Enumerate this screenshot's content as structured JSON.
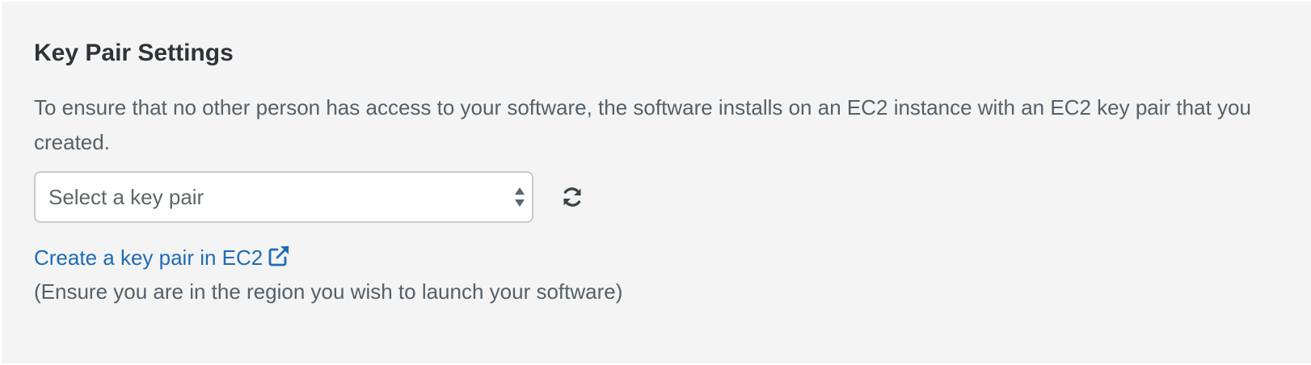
{
  "section": {
    "title": "Key Pair Settings",
    "description": "To ensure that no other person has access to your software, the software installs on an EC2 instance with an EC2 key pair that you created."
  },
  "key_pair_select": {
    "selected": "Select a key pair",
    "icon": "sort-arrows-icon"
  },
  "refresh": {
    "icon": "refresh-icon"
  },
  "create_link": {
    "label": "Create a key pair in EC2",
    "icon": "external-link-icon"
  },
  "region_note": "(Ensure you are in the region you wish to launch your software)",
  "colors": {
    "background": "#f3f4f3",
    "title": "#2f3337",
    "body_text": "#56606a",
    "link": "#1f6bb6",
    "select_border": "#c7cacd"
  }
}
